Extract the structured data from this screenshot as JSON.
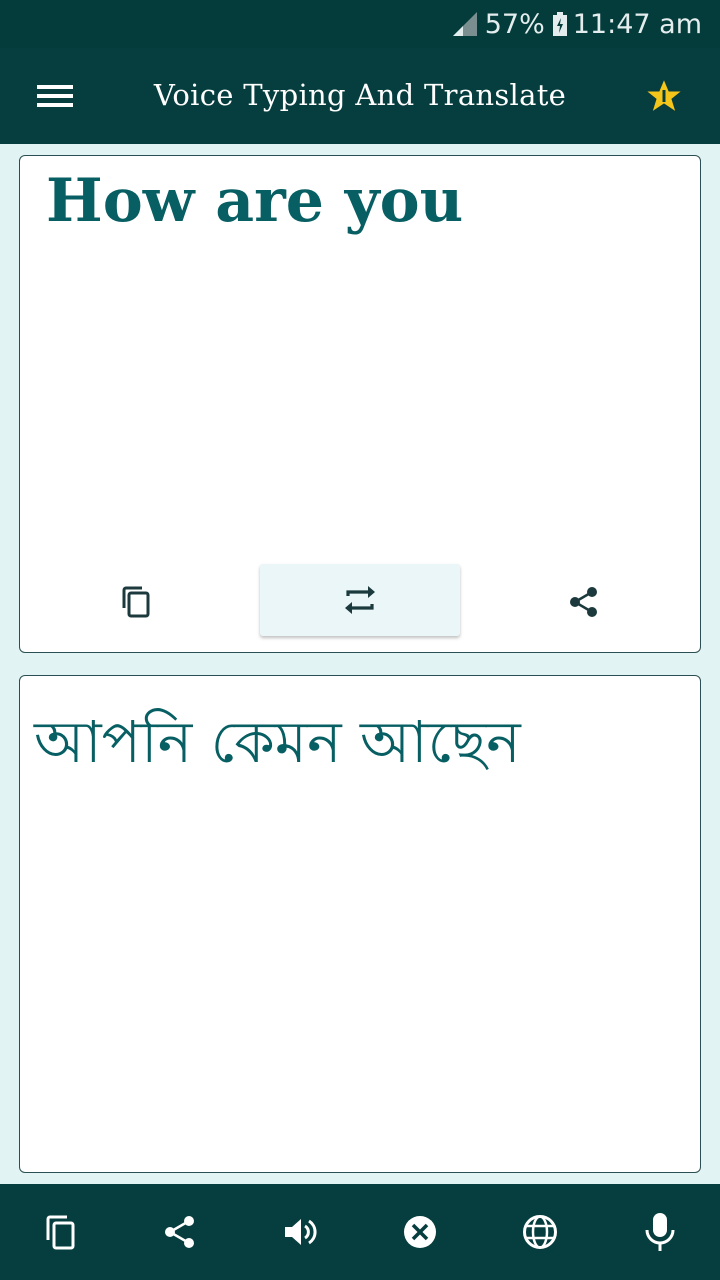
{
  "status_bar": {
    "battery": "57%",
    "time": "11:47 am"
  },
  "app_bar": {
    "title": "Voice Typing And Translate"
  },
  "source": {
    "text": "How are you"
  },
  "target": {
    "text": "আপনি কেমন আছেন"
  },
  "colors": {
    "primary_dark": "#063d3e",
    "accent_text": "#075f63",
    "background": "#e2f3f3",
    "star": "#f5c61a"
  },
  "icons": {
    "menu": "menu-icon",
    "rate": "star-icon",
    "copy": "copy-icon",
    "swap": "swap-icon",
    "share": "share-icon",
    "speaker": "speaker-icon",
    "clear": "clear-icon",
    "language": "globe-icon",
    "mic": "mic-icon"
  }
}
